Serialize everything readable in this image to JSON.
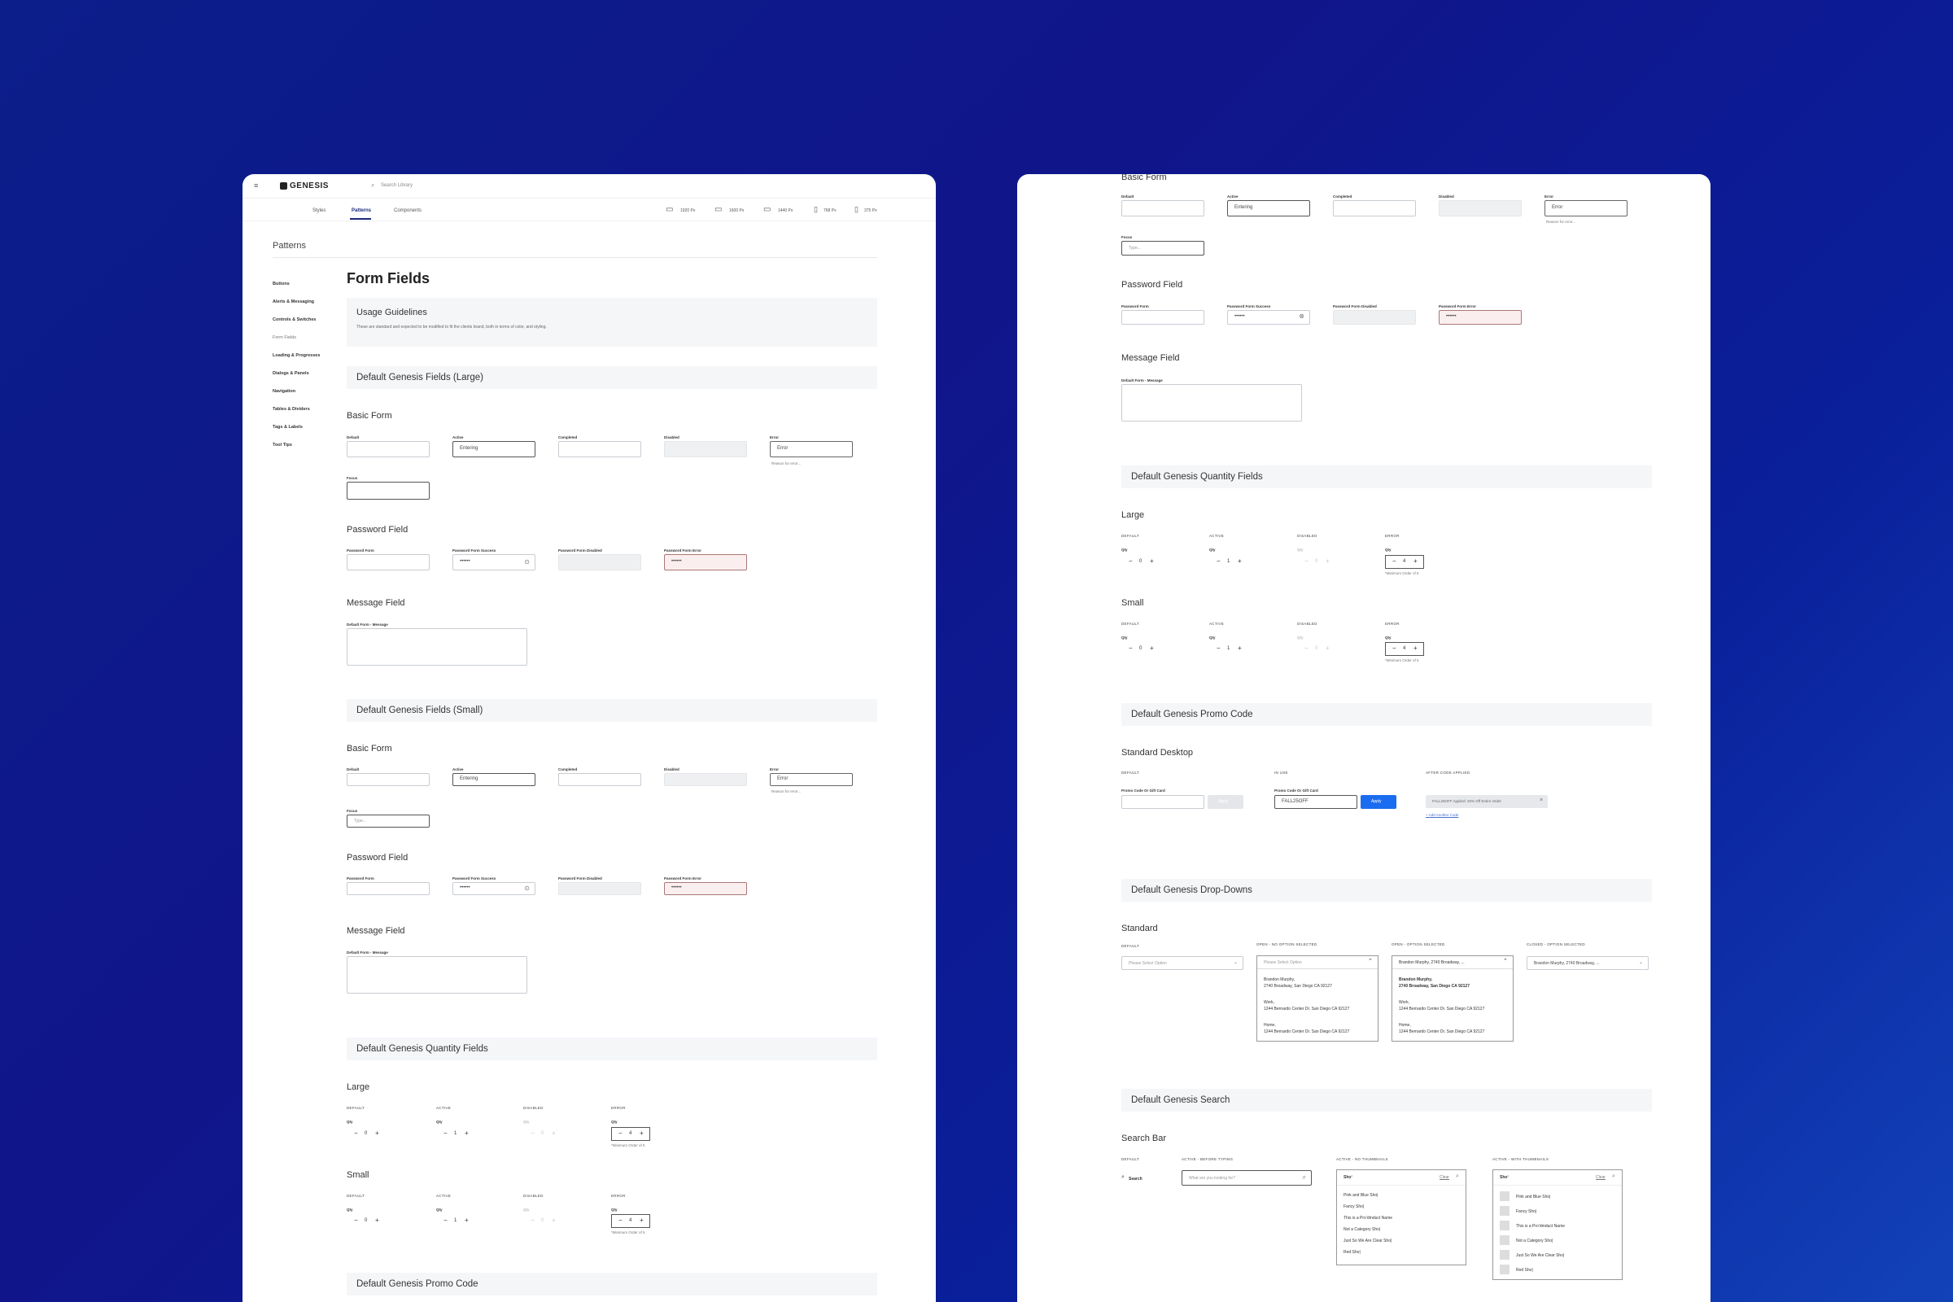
{
  "brand": {
    "name": "GENESIS"
  },
  "header": {
    "search_placeholder": "Search Library",
    "nav": [
      "Styles",
      "Patterns",
      "Components"
    ],
    "breakpoints": [
      "1920 Px",
      "1600 Px",
      "1440 Px",
      "768 Px",
      "375 Px"
    ]
  },
  "sidebar": {
    "title": "Patterns",
    "items": [
      "Buttons",
      "Alerts & Messaging",
      "Controls & Switches",
      "Form Fields",
      "Loading & Progresses",
      "Dialogs & Panels",
      "Navigation",
      "Tables & Dividers",
      "Tags & Labels",
      "Tool Tips"
    ]
  },
  "page": {
    "title": "Form Fields",
    "usage_title": "Usage Guidelines",
    "usage_text": "These are standard and expected to be modified to fit the clients brand, both in terms of color, and styling."
  },
  "labels": {
    "large_section": "Default Genesis Fields (Large)",
    "small_section": "Default Genesis Fields (Small)",
    "qty_section": "Default Genesis Quantity Fields",
    "promo_section": "Default Genesis Promo Code",
    "dropdown_section": "Default Genesis Drop-Downs",
    "search_section": "Default Genesis Search",
    "basic_form": "Basic Form",
    "password_field": "Password Field",
    "message_field": "Message Field",
    "large": "Large",
    "small": "Small",
    "standard_desktop": "Standard Desktop",
    "standard": "Standard",
    "search_bar": "Search Bar",
    "f_default": "Default",
    "f_active": "Active",
    "f_completed": "Completed",
    "f_disabled": "Disabled",
    "f_error": "Error",
    "f_focus": "Focus",
    "v_entering": "Entering",
    "v_error": "Error",
    "v_type": "Type...",
    "error_note": "Reason for error...",
    "p_form": "Password Form",
    "p_success": "Password Form Success",
    "p_disabled": "Password Form Disabled",
    "p_error": "Password Form Error",
    "dots": "••••••",
    "msg": "Default Form - Message",
    "c_default": "DEFAULT",
    "c_active": "ACTIVE",
    "c_disabled": "DISABLED",
    "c_error": "ERROR",
    "qty_label": "Qty",
    "minus": "−",
    "plus": "+",
    "q0": "0",
    "q1": "1",
    "q4": "4",
    "min_note": "*Minimum Order of 5",
    "c_in_use": "IN USE",
    "c_after": "AFTER CODE APPLIED",
    "promo_label": "Promo Code Or Gift Card",
    "promo_value": "FALL25OFF",
    "apply": "Apply",
    "applied": "FALL25OFF Applied: 25% Off Entire Order",
    "add_code": "+ Add Another Code",
    "c_open_none": "OPEN - NO OPTION SELECTED",
    "c_open_sel": "OPEN - OPTION SELECTED",
    "c_closed_sel": "CLOSED - OPTION SELECTED",
    "dd_placeholder": "Please Select Option",
    "dd_selected": "Brandon Murphy, 2740 Broadway, ...",
    "addr1_name": "Brandon Murphy,",
    "addr1": "2740 Broadway, San Diego CA 92127",
    "addr2_name": "Work,",
    "addr2": "1244 Bernardo Center Dr. San Diego CA 92127",
    "addr3_name": "Home,",
    "addr3": "1244 Bernardo Center Dr. San Diego CA 92127",
    "c_before": "ACTIVE - BEFORE TYPING",
    "c_nothumb": "ACTIVE - NO THUMBNAILS",
    "c_thumb": "ACTIVE - WITH THUMBNAILS",
    "search": "Search",
    "search_ph": "What are you looking for?",
    "query": "Shoʻ",
    "clear": "Clear",
    "results": [
      "Pink and Blue Sho|",
      "Fancy Sho|",
      "This is a Proʼdmduct Name",
      "Not a Category Sho|",
      "Just So We Are Clear Sho|",
      "Red Sho|"
    ],
    "results_t": [
      "Pink and Blue Sho|",
      "Fancy Sho|",
      "This is a Proʼdmduct Name",
      "Not a Category Sho|",
      "Just So We Are Clear Sho|",
      "Red Sho|"
    ]
  }
}
